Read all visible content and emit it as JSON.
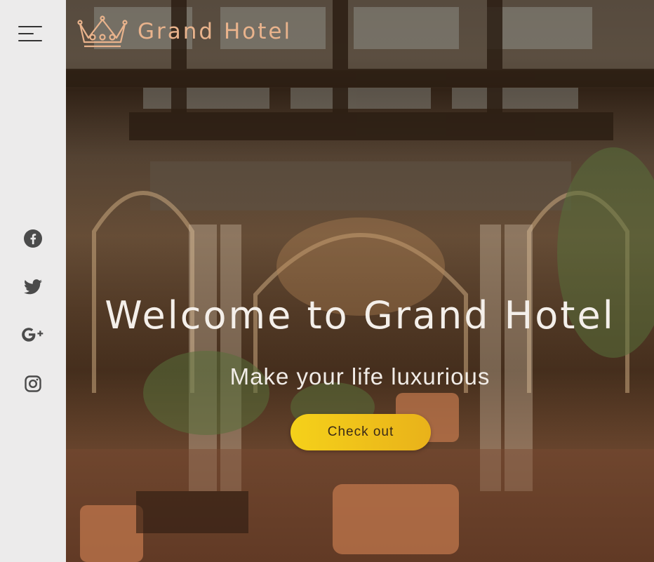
{
  "sidebar": {
    "menu_icon": "hamburger-menu-icon",
    "social": [
      {
        "name": "facebook",
        "icon": "facebook-icon"
      },
      {
        "name": "twitter",
        "icon": "twitter-icon"
      },
      {
        "name": "google-plus",
        "icon": "google-plus-icon"
      },
      {
        "name": "instagram",
        "icon": "instagram-icon"
      }
    ]
  },
  "header": {
    "logo_icon": "crown-icon",
    "brand": "Grand Hotel"
  },
  "hero": {
    "title": "Welcome to Grand Hotel",
    "subtitle": "Make your life luxurious",
    "cta_label": "Check out"
  },
  "colors": {
    "sidebar_bg": "#ecebeb",
    "brand_text": "#e9b38c",
    "cta_start": "#f5d11a",
    "cta_end": "#e9b21a",
    "icon_gray": "#4b4b4b"
  }
}
